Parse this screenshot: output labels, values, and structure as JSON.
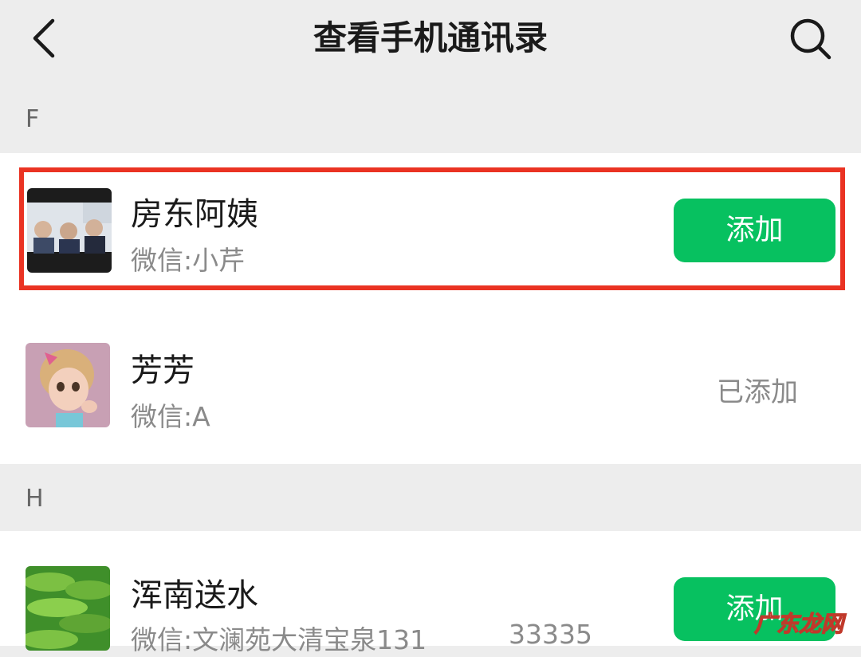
{
  "header": {
    "title": "查看手机通讯录",
    "back_icon": "chevron-left-icon",
    "search_icon": "search-icon"
  },
  "sections": [
    {
      "letter": "F",
      "contacts": [
        {
          "name": "房东阿姨",
          "wechat": "微信:小芹",
          "action": "添加",
          "highlighted": true
        },
        {
          "name": "芳芳",
          "wechat": "微信:A",
          "action": "已添加",
          "highlighted": false
        }
      ]
    },
    {
      "letter": "H",
      "contacts": [
        {
          "name": "浑南送水",
          "wechat": "微信:文澜苑大清宝泉131",
          "wechat_extra": "33335",
          "action": "添加",
          "highlighted": false
        }
      ]
    }
  ],
  "watermark": {
    "text": "广东龙网"
  },
  "colors": {
    "background": "#ededed",
    "add_button": "#07c160",
    "highlight_border": "#ea3323",
    "muted_text": "#8a8a8a"
  }
}
